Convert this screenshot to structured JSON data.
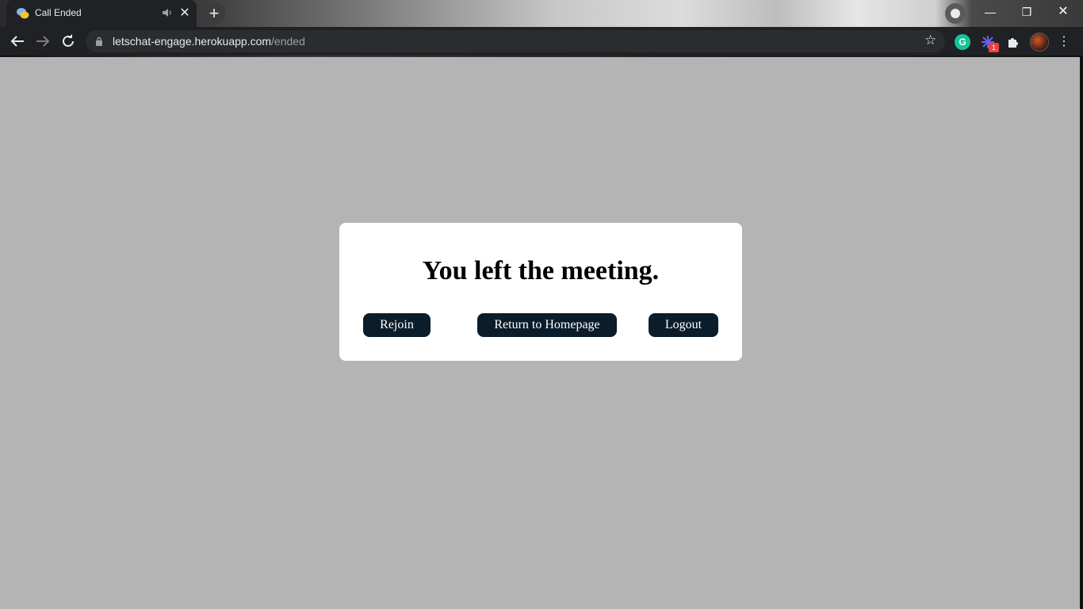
{
  "browser": {
    "tab": {
      "title": "Call Ended"
    },
    "address": {
      "host": "letschat-engage.herokuapp.com",
      "path": "/ended"
    },
    "extensions": {
      "grammarly_letter": "G",
      "badge_count": "1"
    }
  },
  "dialog": {
    "title": "You left the meeting.",
    "buttons": {
      "rejoin": "Rejoin",
      "home": "Return to Homepage",
      "logout": "Logout"
    }
  },
  "colors": {
    "page_background": "#b4b4b4",
    "button_background": "#0b1c2a",
    "dialog_background": "#ffffff"
  }
}
